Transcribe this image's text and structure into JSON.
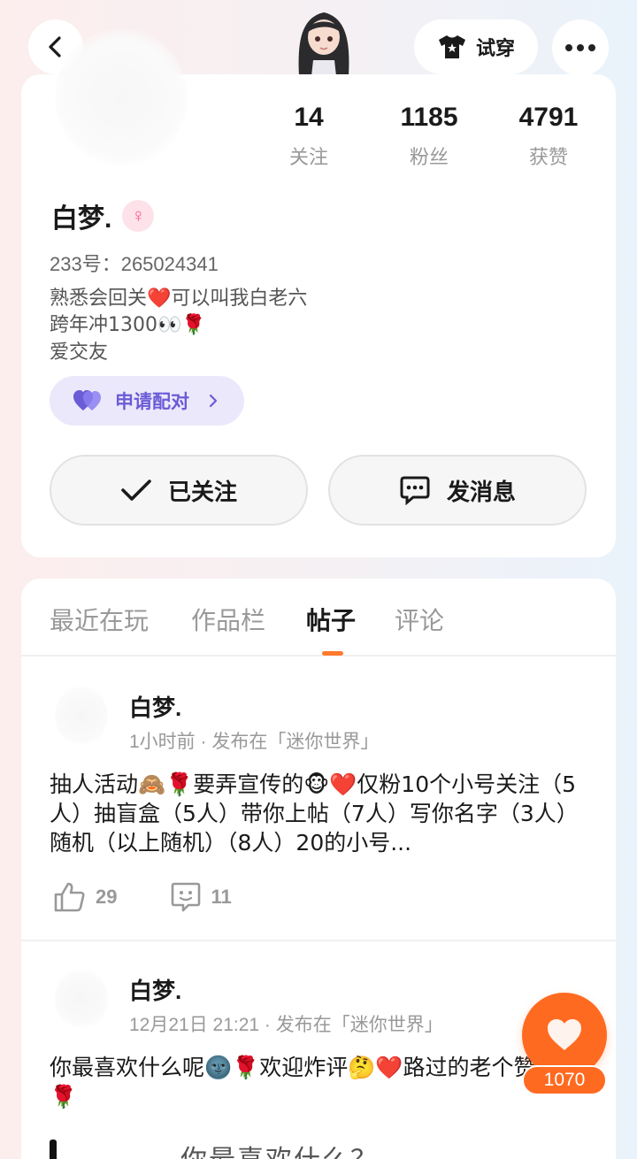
{
  "header": {
    "tryon_label": "试穿"
  },
  "profile": {
    "stats": [
      {
        "value": "14",
        "label": "关注"
      },
      {
        "value": "1185",
        "label": "粉丝"
      },
      {
        "value": "4791",
        "label": "获赞"
      }
    ],
    "name": "白梦.",
    "gender_symbol": "♀",
    "uid": "233号：265024341",
    "bio_lines": [
      "熟悉会回关❤️可以叫我白老六",
      "跨年冲1300👀🌹",
      "爱交友"
    ],
    "pair_label": "申请配对",
    "follow_label": "已关注",
    "message_label": "发消息"
  },
  "tabs": [
    {
      "label": "最近在玩",
      "active": false
    },
    {
      "label": "作品栏",
      "active": false
    },
    {
      "label": "帖子",
      "active": true
    },
    {
      "label": "评论",
      "active": false
    }
  ],
  "posts": [
    {
      "author": "白梦.",
      "meta": "1小时前 · 发布在「迷你世界」",
      "text": "抽人活动🙈🌹要弄宣传的🐵❤️仅粉10个小号关注（5人）抽盲盒（5人）带你上帖（7人）写你名字（3人）随机（以上随机）（8人）20的小号...",
      "likes": "29",
      "comments": "11"
    },
    {
      "author": "白梦.",
      "meta": "12月21日 21:21 · 发布在「迷你世界」",
      "text": "你最喜欢什么呢🌚🌹欢迎炸评🤔❤️路过的老个赞吧🙈🌹",
      "image_text": "你最喜欢什么？"
    }
  ],
  "fab": {
    "like_count": "1070"
  },
  "colors": {
    "accent": "#ff6a21",
    "tab_indicator": "#ff7a2d",
    "pair_purple": "#6a5bd6"
  }
}
